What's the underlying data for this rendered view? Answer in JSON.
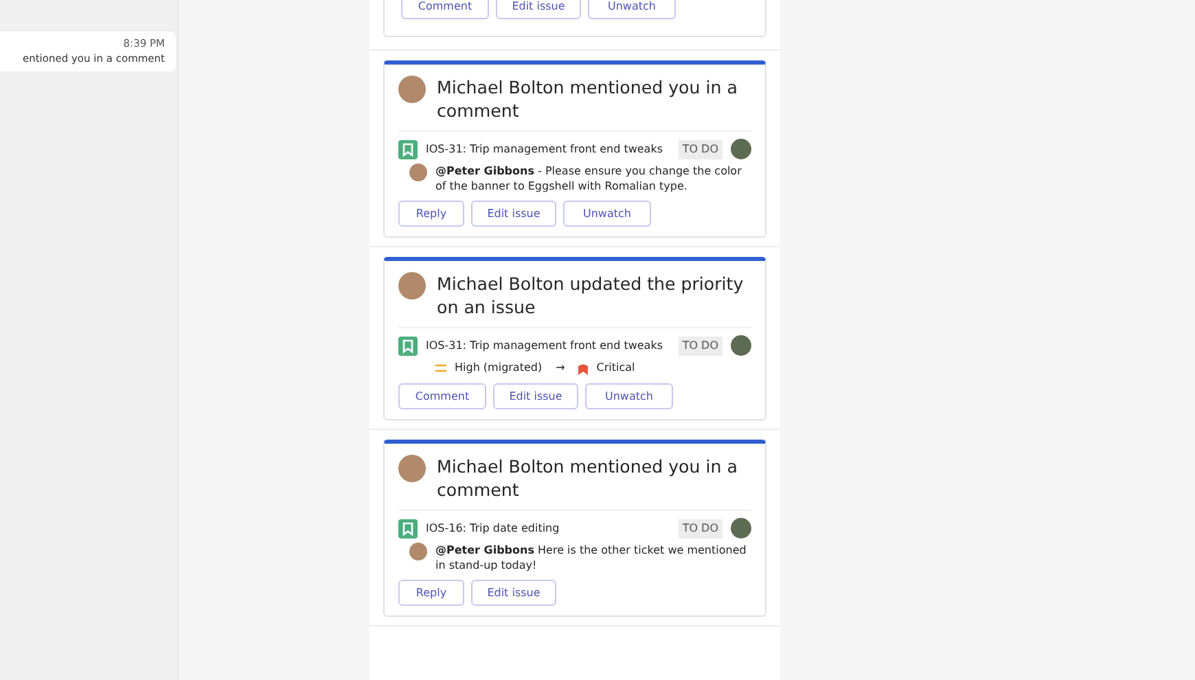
{
  "side_panel": {
    "chat_preview": {
      "time": "8:39 PM",
      "text": "entioned you in a comment"
    }
  },
  "feed": [
    {
      "kind": "partial",
      "buttons": [
        "Comment",
        "Edit issue",
        "Unwatch"
      ]
    },
    {
      "kind": "comment",
      "title": "Michael Bolton mentioned you in a comment",
      "issue": {
        "key_title": "IOS-31: Trip management front end tweaks",
        "status": "TO DO"
      },
      "comment": "**@Peter Gibbons** - Please ensure you change the color of the banner to Eggshell with Romalian type.",
      "buttons": [
        "Reply",
        "Edit issue",
        "Unwatch"
      ]
    },
    {
      "kind": "priority",
      "title": "Michael Bolton updated the priority on an issue",
      "issue": {
        "key_title": "IOS-31: Trip management front end tweaks",
        "status": "TO DO"
      },
      "change": {
        "from": "High (migrated)",
        "arrow": "→",
        "to": "Critical"
      },
      "buttons": [
        "Comment",
        "Edit issue",
        "Unwatch"
      ]
    },
    {
      "kind": "comment",
      "title": "Michael Bolton mentioned you in a comment",
      "issue": {
        "key_title": "IOS-16: Trip date editing",
        "status": "TO DO"
      },
      "comment": "**@Peter Gibbons** Here is the other ticket we mentioned in stand-up today!",
      "buttons": [
        "Reply",
        "Edit issue"
      ]
    }
  ]
}
